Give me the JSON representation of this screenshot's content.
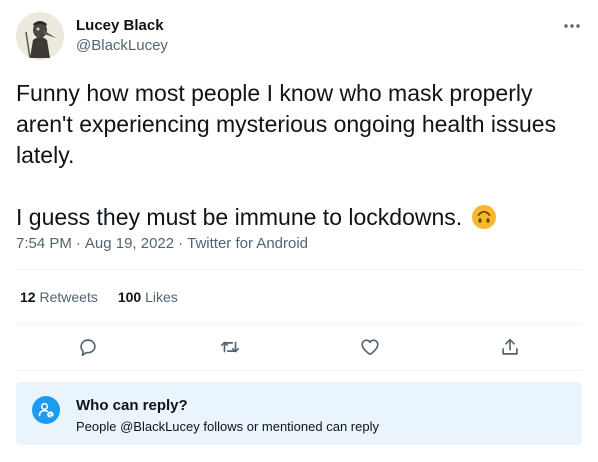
{
  "author": {
    "name": "Lucey Black",
    "handle": "@BlackLucey"
  },
  "tweet": {
    "paragraph1": "Funny how most people I know who mask properly aren't experiencing mysterious ongoing health issues lately.",
    "paragraph2": "I guess they must be immune to lockdowns.",
    "emoji": "upside-down-face-emoji",
    "time": "7:54 PM",
    "separator": "·",
    "date": "Aug 19, 2022",
    "source": "Twitter for Android"
  },
  "stats": {
    "retweets_count": "12",
    "retweets_label": "Retweets",
    "likes_count": "100",
    "likes_label": "Likes"
  },
  "actions": {
    "icons": [
      "reply-icon",
      "retweet-icon",
      "like-icon",
      "share-icon"
    ]
  },
  "reply_restriction": {
    "title": "Who can reply?",
    "description": "People @BlackLucey follows or mentioned can reply",
    "icon": "mention-person-icon"
  },
  "colors": {
    "accent": "#1d9bf0",
    "secondary_text": "#536471",
    "primary_text": "#0f1419",
    "info_box_bg": "#eaf4fd",
    "divider": "#eff3f4",
    "emoji_yellow": "#f7b72e"
  }
}
